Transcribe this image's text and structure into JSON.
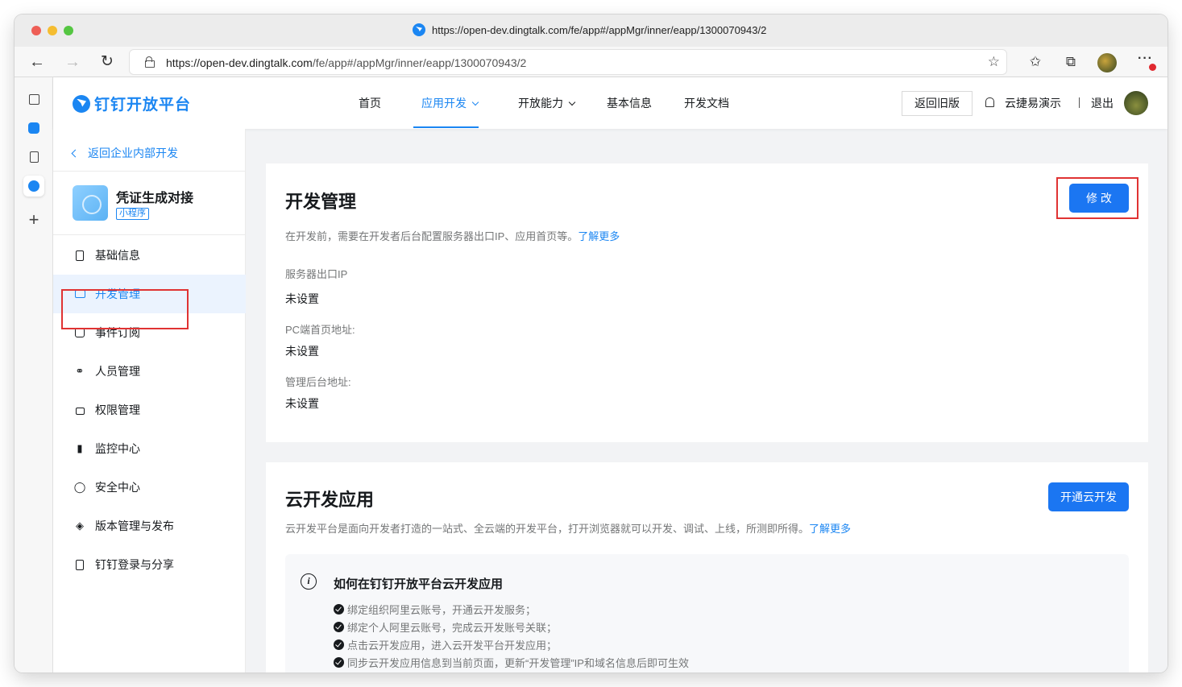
{
  "browser": {
    "tab_title": "https://open-dev.dingtalk.com/fe/app#/appMgr/inner/eapp/1300070943/2",
    "url_host": "https://open-dev.dingtalk.com",
    "url_path": "/fe/app#/appMgr/inner/eapp/1300070943/2",
    "icons": [
      "back-arrow-icon",
      "forward-arrow-icon",
      "reload-icon",
      "lock-icon",
      "favorite-add-icon",
      "favorites-icon",
      "collections-icon",
      "profile-avatar",
      "more-icon"
    ]
  },
  "header": {
    "logo_text": "钉钉开放平台",
    "nav": [
      "首页",
      "应用开发",
      "开放能力",
      "基本信息",
      "开发文档"
    ],
    "active_nav": "应用开发",
    "old_version_button": "返回旧版",
    "user_name": "云捷易演示",
    "logout": "退出"
  },
  "leftnav": {
    "back_link": "返回企业内部开发",
    "app_name": "凭证生成对接",
    "app_tag": "小程序",
    "items": [
      {
        "label": "基础信息",
        "icon": "file-icon"
      },
      {
        "label": "开发管理",
        "icon": "monitor-icon",
        "active": true
      },
      {
        "label": "事件订阅",
        "icon": "subscribe-icon"
      },
      {
        "label": "人员管理",
        "icon": "user-icon"
      },
      {
        "label": "权限管理",
        "icon": "lock-icon"
      },
      {
        "label": "监控中心",
        "icon": "bar-chart-icon"
      },
      {
        "label": "安全中心",
        "icon": "shield-icon"
      },
      {
        "label": "版本管理与发布",
        "icon": "layers-icon"
      },
      {
        "label": "钉钉登录与分享",
        "icon": "share-icon"
      }
    ]
  },
  "dev_management": {
    "title": "开发管理",
    "description": "在开发前，需要在开发者后台配置服务器出口IP、应用首页等。",
    "learn_more": "了解更多",
    "edit_button": "修 改",
    "fields": [
      {
        "label": "服务器出口IP",
        "value": "未设置"
      },
      {
        "label": "PC端首页地址:",
        "value": "未设置"
      },
      {
        "label": "管理后台地址:",
        "value": "未设置"
      }
    ]
  },
  "cloud_dev": {
    "title": "云开发应用",
    "description": "云开发平台是面向开发者打造的一站式、全云端的开发平台，打开浏览器就可以开发、调试、上线，所测即所得。",
    "learn_more": "了解更多",
    "open_button": "开通云开发",
    "info_title": "如何在钉钉开放平台云开发应用",
    "steps": [
      "绑定组织阿里云账号，开通云开发服务；",
      "绑定个人阿里云账号，完成云开发账号关联；",
      "点击云开发应用，进入云开发平台开发应用；",
      "同步云开发应用信息到当前页面，更新“开发管理”IP和域名信息后即可生效"
    ]
  },
  "colors": {
    "primary": "#1b76f2",
    "brand_blue": "#1b86f2",
    "highlight_border": "#e03333"
  }
}
